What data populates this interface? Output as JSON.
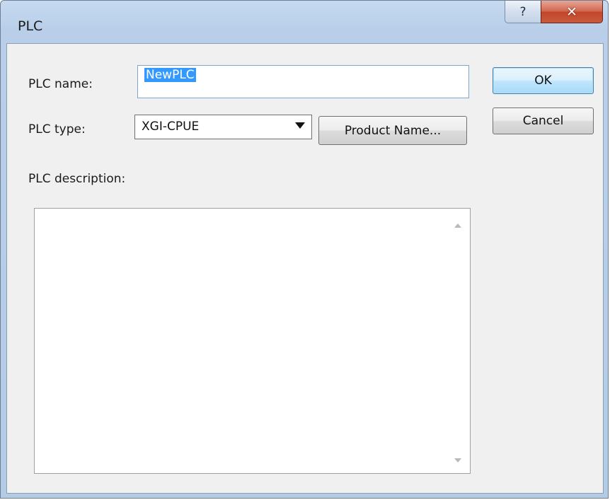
{
  "window": {
    "title": "PLC"
  },
  "titlebar": {
    "help_glyph": "?",
    "close_glyph": "✕"
  },
  "form": {
    "plc_name_label": "PLC name:",
    "plc_name_value": "NewPLC",
    "plc_type_label": "PLC type:",
    "plc_type_value": "XGI-CPUE",
    "product_name_button": "Product Name...",
    "plc_description_label": "PLC description:",
    "plc_description_value": ""
  },
  "buttons": {
    "ok": "OK",
    "cancel": "Cancel"
  },
  "icons": {
    "help": "help-icon",
    "close": "close-icon",
    "dropdown": "chevron-down-icon",
    "scroll_up": "scroll-up-arrow-icon",
    "scroll_down": "scroll-down-arrow-icon"
  },
  "colors": {
    "titlebar": "#b9cfe9",
    "close_button": "#c85a3c",
    "selection": "#3399ff",
    "default_button": "#bee6fd"
  }
}
